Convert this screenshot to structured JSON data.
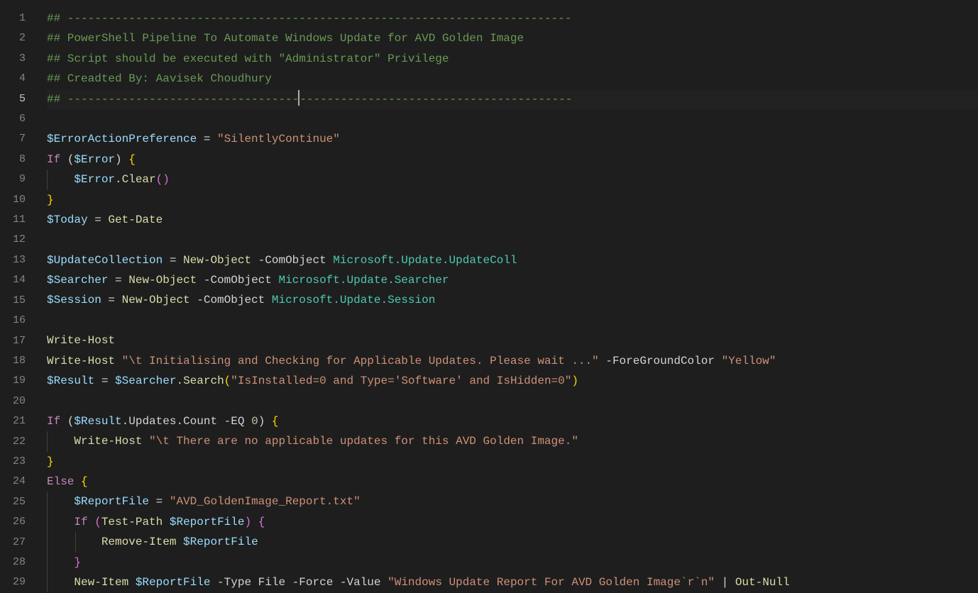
{
  "active_line": 5,
  "lines": [
    {
      "n": 1,
      "tokens": [
        [
          "comment",
          "## --------------------------------------------------------------------------"
        ]
      ]
    },
    {
      "n": 2,
      "tokens": [
        [
          "comment",
          "## PowerShell Pipeline To Automate Windows Update for AVD Golden Image"
        ]
      ]
    },
    {
      "n": 3,
      "tokens": [
        [
          "comment",
          "## Script should be executed with \"Administrator\" Privilege"
        ]
      ]
    },
    {
      "n": 4,
      "tokens": [
        [
          "comment",
          "## Creadted By: Aavisek Choudhury"
        ]
      ]
    },
    {
      "n": 5,
      "tokens": [
        [
          "comment",
          "## ----------------------------------"
        ],
        [
          "cursor",
          ""
        ],
        [
          "comment",
          "----------------------------------------"
        ]
      ]
    },
    {
      "n": 6,
      "tokens": []
    },
    {
      "n": 7,
      "tokens": [
        [
          "var",
          "$ErrorActionPreference"
        ],
        [
          "op",
          " = "
        ],
        [
          "string",
          "\"SilentlyContinue\""
        ]
      ]
    },
    {
      "n": 8,
      "tokens": [
        [
          "keyword",
          "If"
        ],
        [
          "plain",
          " "
        ],
        [
          "paren",
          "("
        ],
        [
          "var",
          "$Error"
        ],
        [
          "paren",
          ")"
        ],
        [
          "plain",
          " "
        ],
        [
          "curbra",
          "{"
        ]
      ]
    },
    {
      "n": 9,
      "tokens": [
        [
          "plain",
          "    "
        ],
        [
          "var",
          "$Error"
        ],
        [
          "plain",
          "."
        ],
        [
          "cmdlet",
          "Clear"
        ],
        [
          "curbra2",
          "()"
        ]
      ]
    },
    {
      "n": 10,
      "tokens": [
        [
          "curbra",
          "}"
        ]
      ]
    },
    {
      "n": 11,
      "tokens": [
        [
          "var",
          "$Today"
        ],
        [
          "op",
          " = "
        ],
        [
          "cmdlet",
          "Get-Date"
        ]
      ]
    },
    {
      "n": 12,
      "tokens": []
    },
    {
      "n": 13,
      "tokens": [
        [
          "var",
          "$UpdateCollection"
        ],
        [
          "op",
          " = "
        ],
        [
          "cmdlet",
          "New-Object"
        ],
        [
          "plain",
          " -ComObject "
        ],
        [
          "type",
          "Microsoft.Update.UpdateColl"
        ]
      ]
    },
    {
      "n": 14,
      "tokens": [
        [
          "var",
          "$Searcher"
        ],
        [
          "op",
          " = "
        ],
        [
          "cmdlet",
          "New-Object"
        ],
        [
          "plain",
          " -ComObject "
        ],
        [
          "type",
          "Microsoft.Update.Searcher"
        ]
      ]
    },
    {
      "n": 15,
      "tokens": [
        [
          "var",
          "$Session"
        ],
        [
          "op",
          " = "
        ],
        [
          "cmdlet",
          "New-Object"
        ],
        [
          "plain",
          " -ComObject "
        ],
        [
          "type",
          "Microsoft.Update.Session"
        ]
      ]
    },
    {
      "n": 16,
      "tokens": []
    },
    {
      "n": 17,
      "tokens": [
        [
          "cmdlet",
          "Write-Host"
        ]
      ]
    },
    {
      "n": 18,
      "tokens": [
        [
          "cmdlet",
          "Write-Host"
        ],
        [
          "plain",
          " "
        ],
        [
          "string",
          "\"\\t Initialising and Checking for Applicable Updates. Please wait ...\""
        ],
        [
          "plain",
          " -ForeGroundColor "
        ],
        [
          "string",
          "\"Yellow\""
        ]
      ]
    },
    {
      "n": 19,
      "tokens": [
        [
          "var",
          "$Result"
        ],
        [
          "op",
          " = "
        ],
        [
          "var",
          "$Searcher"
        ],
        [
          "plain",
          "."
        ],
        [
          "cmdlet",
          "Search"
        ],
        [
          "curbra",
          "("
        ],
        [
          "string",
          "\"IsInstalled=0 and Type='Software' and IsHidden=0\""
        ],
        [
          "curbra",
          ")"
        ]
      ]
    },
    {
      "n": 20,
      "tokens": []
    },
    {
      "n": 21,
      "tokens": [
        [
          "keyword",
          "If"
        ],
        [
          "plain",
          " "
        ],
        [
          "paren",
          "("
        ],
        [
          "var",
          "$Result"
        ],
        [
          "plain",
          ".Updates.Count "
        ],
        [
          "op",
          "-EQ"
        ],
        [
          "plain",
          " "
        ],
        [
          "number",
          "0"
        ],
        [
          "paren",
          ")"
        ],
        [
          "plain",
          " "
        ],
        [
          "curbra",
          "{"
        ]
      ]
    },
    {
      "n": 22,
      "tokens": [
        [
          "plain",
          "    "
        ],
        [
          "cmdlet",
          "Write-Host"
        ],
        [
          "plain",
          " "
        ],
        [
          "string",
          "\"\\t There are no applicable updates for this AVD Golden Image.\""
        ]
      ]
    },
    {
      "n": 23,
      "tokens": [
        [
          "curbra",
          "}"
        ]
      ]
    },
    {
      "n": 24,
      "tokens": [
        [
          "keyword",
          "Else"
        ],
        [
          "plain",
          " "
        ],
        [
          "curbra",
          "{"
        ]
      ]
    },
    {
      "n": 25,
      "tokens": [
        [
          "plain",
          "    "
        ],
        [
          "var",
          "$ReportFile"
        ],
        [
          "op",
          " = "
        ],
        [
          "string",
          "\"AVD_GoldenImage_Report.txt\""
        ]
      ]
    },
    {
      "n": 26,
      "tokens": [
        [
          "plain",
          "    "
        ],
        [
          "keyword",
          "If"
        ],
        [
          "plain",
          " "
        ],
        [
          "curbra2",
          "("
        ],
        [
          "cmdlet",
          "Test-Path"
        ],
        [
          "plain",
          " "
        ],
        [
          "var",
          "$ReportFile"
        ],
        [
          "curbra2",
          ")"
        ],
        [
          "plain",
          " "
        ],
        [
          "curbra2",
          "{"
        ]
      ]
    },
    {
      "n": 27,
      "tokens": [
        [
          "plain",
          "        "
        ],
        [
          "cmdlet",
          "Remove-Item"
        ],
        [
          "plain",
          " "
        ],
        [
          "var",
          "$ReportFile"
        ]
      ]
    },
    {
      "n": 28,
      "tokens": [
        [
          "plain",
          "    "
        ],
        [
          "curbra2",
          "}"
        ]
      ]
    },
    {
      "n": 29,
      "tokens": [
        [
          "plain",
          "    "
        ],
        [
          "cmdlet",
          "New-Item"
        ],
        [
          "plain",
          " "
        ],
        [
          "var",
          "$ReportFile"
        ],
        [
          "plain",
          " -Type "
        ],
        [
          "plain",
          "File"
        ],
        [
          "plain",
          " -Force -Value "
        ],
        [
          "string",
          "\"Windows Update Report For AVD Golden Image`r`n\""
        ],
        [
          "plain",
          " "
        ],
        [
          "pipe",
          "|"
        ],
        [
          "plain",
          " "
        ],
        [
          "cmdlet",
          "Out-Null"
        ]
      ]
    }
  ]
}
